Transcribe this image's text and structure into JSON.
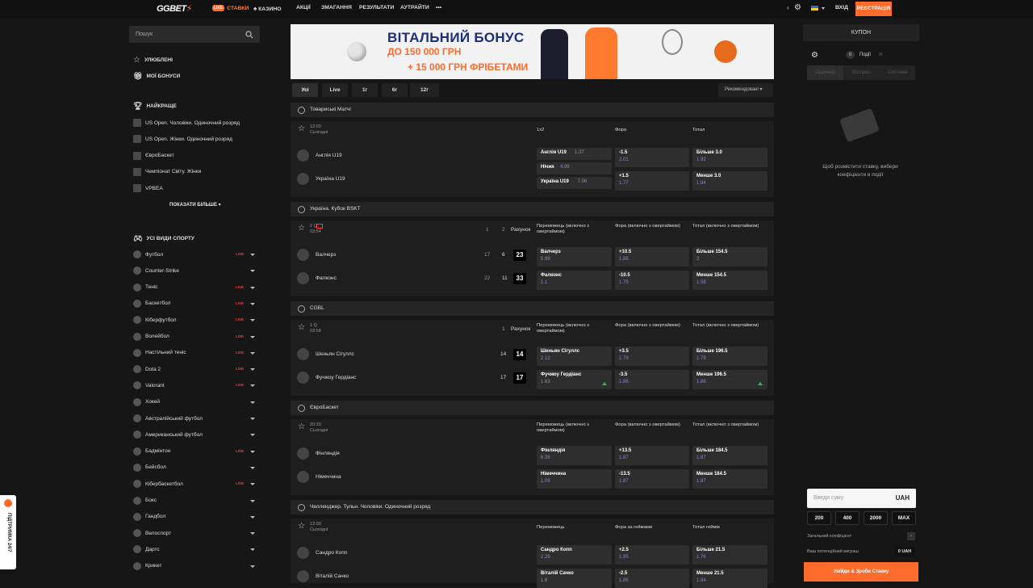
{
  "header": {
    "logo": "GGBET",
    "nav": [
      {
        "label": "СТАВКИ",
        "badge": "LIVE"
      },
      {
        "label": "КАЗИНО"
      },
      {
        "label": "АКЦІЇ"
      },
      {
        "label": "ЗМАГАННЯ"
      },
      {
        "label": "РЕЗУЛЬТАТИ"
      },
      {
        "label": "АУТРАЙТИ"
      }
    ],
    "more": "•••",
    "login": "ВХІД",
    "register": "РЕЄСТРАЦІЯ"
  },
  "sidebar": {
    "search_placeholder": "Пошук",
    "favorites": "УЛЮБЛЕНІ",
    "bonuses": "МОЇ БОНУСИ",
    "best_head": "НАЙКРАЩЕ",
    "best": [
      "US Open. Чоловіки. Одиночний розряд",
      "US Open. Жінки. Одиночний розряд",
      "ЄвроБаскет",
      "Чемпіонат Світу. Жінки",
      "VPBEA"
    ],
    "show_more": "ПОКАЗАТИ БІЛЬШЕ",
    "sports_head": "УСІ ВИДИ СПОРТУ",
    "sports": [
      {
        "name": "Футбол",
        "live": true
      },
      {
        "name": "Counter-Strike",
        "live": false
      },
      {
        "name": "Теніс",
        "live": true
      },
      {
        "name": "Баскетбол",
        "live": true
      },
      {
        "name": "Кіберфутбол",
        "live": true
      },
      {
        "name": "Волейбол",
        "live": true
      },
      {
        "name": "Настільний теніс",
        "live": true
      },
      {
        "name": "Dota 2",
        "live": true
      },
      {
        "name": "Valorant",
        "live": true
      },
      {
        "name": "Хокей",
        "live": false
      },
      {
        "name": "Австралійський футбол",
        "live": false
      },
      {
        "name": "Американський футбол",
        "live": false
      },
      {
        "name": "Бадмінтон",
        "live": true
      },
      {
        "name": "Бейсбол",
        "live": false
      },
      {
        "name": "Кібербаскетбол",
        "live": true
      },
      {
        "name": "Бокс",
        "live": false
      },
      {
        "name": "Гандбол",
        "live": false
      },
      {
        "name": "Велоспорт",
        "live": false
      },
      {
        "name": "Дартс",
        "live": false
      },
      {
        "name": "Крикет",
        "live": false
      }
    ],
    "live_label": "LIVE"
  },
  "banner": {
    "line1": "ВІТАЛЬНИЙ БОНУС",
    "line2": "ДО 150 000 ГРН",
    "line3": "+ 15 000 ГРН ФРІБЕТАМИ"
  },
  "tabs": [
    "Усі",
    "Live",
    "1г",
    "6г",
    "12г"
  ],
  "sort": "Рекомендовані",
  "sections": [
    {
      "title": "Товариські Матчі",
      "time": "12:00",
      "day": "Сьогодні",
      "cols": [
        "1x2",
        "Фора",
        "Тотал"
      ],
      "teams": [
        "Англія U19",
        "Україна U19"
      ],
      "c1": [
        {
          "l": "Англія U19",
          "v": "1.37"
        },
        {
          "l": "Нічия",
          "v": "4.99"
        },
        {
          "l": "Україна U19",
          "v": "7.06"
        }
      ],
      "c2": [
        {
          "l": "-1.5",
          "v": "2.01"
        },
        {
          "l": "+1.5",
          "v": "1.77"
        }
      ],
      "c3": [
        {
          "l": "Більше 3.0",
          "v": "1.92"
        },
        {
          "l": "Менше 3.0",
          "v": "1.84"
        }
      ]
    },
    {
      "title": "Україна. Кубок BSKT",
      "time": "2 Q",
      "day": "03:54",
      "score_cols": [
        "1",
        "2",
        "Рахунок"
      ],
      "cols": [
        "Переможець (включно з овертаймом)",
        "Фора (включно з овертаймом)",
        "Тотал (включно з овертаймом)"
      ],
      "teams": [
        "Валчерз",
        "Фалконс"
      ],
      "scores": [
        [
          "17",
          "6",
          "23"
        ],
        [
          "22",
          "11",
          "33"
        ]
      ],
      "c1": [
        {
          "l": "Валчерз",
          "v": "5.99"
        },
        {
          "l": "Фалконс",
          "v": "1.1"
        }
      ],
      "c2": [
        {
          "l": "+10.5",
          "v": "1.86"
        },
        {
          "l": "-10.5",
          "v": "1.79"
        }
      ],
      "c3": [
        {
          "l": "Більше 154.5",
          "v": "2"
        },
        {
          "l": "Менше 154.5",
          "v": "1.58"
        }
      ]
    },
    {
      "title": "CGBL",
      "time": "1 Q",
      "day": "03:58",
      "score_cols": [
        "1",
        "Рахунок"
      ],
      "cols": [
        "Переможець (включно з овертаймом)",
        "Фора (включно з овертаймом)",
        "Тотал (включно з овертаймом)"
      ],
      "teams": [
        "Шеньян Сігуллс",
        "Фучжоу Гердіанс"
      ],
      "scores": [
        [
          "14",
          "14"
        ],
        [
          "17",
          "17"
        ]
      ],
      "c1": [
        {
          "l": "Шеньян Сігуллс",
          "v": "2.12"
        },
        {
          "l": "Фучжоу Гердіанс",
          "v": "1.63"
        }
      ],
      "c2": [
        {
          "l": "+3.5",
          "v": "1.79"
        },
        {
          "l": "-3.5",
          "v": "1.86"
        }
      ],
      "c3": [
        {
          "l": "Більше 196.5",
          "v": "1.79"
        },
        {
          "l": "Менше 196.5",
          "v": "1.86"
        }
      ]
    },
    {
      "title": "ЄвроБаскет",
      "time": "20:30",
      "day": "Сьогодні",
      "cols": [
        "Переможець (включно з овертаймом)",
        "Фора (включно з овертаймом)",
        "Тотал (включно з овертаймом)"
      ],
      "teams": [
        "Фінляндія",
        "Німеччина"
      ],
      "c1": [
        {
          "l": "Фінляндія",
          "v": "6.39"
        },
        {
          "l": "Німеччина",
          "v": "1.09"
        }
      ],
      "c2": [
        {
          "l": "+13.5",
          "v": "1.87"
        },
        {
          "l": "-13.5",
          "v": "1.87"
        }
      ],
      "c3": [
        {
          "l": "Більше 184.5",
          "v": "1.87"
        },
        {
          "l": "Менше 184.5",
          "v": "1.87"
        }
      ]
    },
    {
      "title": "Челленджер. Тульн. Чоловіки. Одиночний розряд",
      "time": "12:00",
      "day": "Сьогодні",
      "cols": [
        "Переможець",
        "Фора за геймами",
        "Тотал геймів"
      ],
      "teams": [
        "Сандро Копп",
        "Віталій Сачко"
      ],
      "c1": [
        {
          "l": "Сандро Копп",
          "v": "2.29"
        },
        {
          "l": "Віталій Сачко",
          "v": "1.6"
        }
      ],
      "c2": [
        {
          "l": "+2.5",
          "v": "1.85"
        },
        {
          "l": "-2.5",
          "v": "1.85"
        }
      ],
      "c3": [
        {
          "l": "Більше 21.5",
          "v": "1.76"
        },
        {
          "l": "Менше 21.5",
          "v": "1.94"
        }
      ]
    }
  ],
  "coupon": {
    "title": "КУПОН",
    "events_count": "0",
    "events_label": "Події",
    "tabs": [
      "Ординар",
      "Експрес",
      "Система"
    ],
    "empty_text": "Щоб розмістити ставку, вибери коефіцієнти в події",
    "amount_placeholder": "Введи суму",
    "currency": "UAH",
    "quick": [
      "200",
      "400",
      "2000",
      "MAX"
    ],
    "total_coef_label": "Загальний коефіцієнт",
    "total_coef_value": "-",
    "win_label": "Ваш потенційний виграш",
    "win_value": "0 UAH",
    "place_button": "Увійди & Зроби Ставку"
  },
  "support": "ПІДТРИМКА 24/7"
}
